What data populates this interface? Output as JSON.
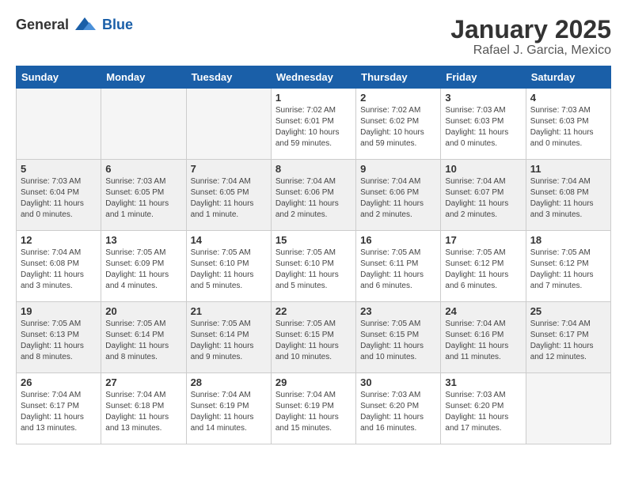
{
  "logo": {
    "general": "General",
    "blue": "Blue"
  },
  "header": {
    "title": "January 2025",
    "subtitle": "Rafael J. Garcia, Mexico"
  },
  "weekdays": [
    "Sunday",
    "Monday",
    "Tuesday",
    "Wednesday",
    "Thursday",
    "Friday",
    "Saturday"
  ],
  "weeks": [
    [
      {
        "day": "",
        "info": ""
      },
      {
        "day": "",
        "info": ""
      },
      {
        "day": "",
        "info": ""
      },
      {
        "day": "1",
        "info": "Sunrise: 7:02 AM\nSunset: 6:01 PM\nDaylight: 10 hours\nand 59 minutes."
      },
      {
        "day": "2",
        "info": "Sunrise: 7:02 AM\nSunset: 6:02 PM\nDaylight: 10 hours\nand 59 minutes."
      },
      {
        "day": "3",
        "info": "Sunrise: 7:03 AM\nSunset: 6:03 PM\nDaylight: 11 hours\nand 0 minutes."
      },
      {
        "day": "4",
        "info": "Sunrise: 7:03 AM\nSunset: 6:03 PM\nDaylight: 11 hours\nand 0 minutes."
      }
    ],
    [
      {
        "day": "5",
        "info": "Sunrise: 7:03 AM\nSunset: 6:04 PM\nDaylight: 11 hours\nand 0 minutes."
      },
      {
        "day": "6",
        "info": "Sunrise: 7:03 AM\nSunset: 6:05 PM\nDaylight: 11 hours\nand 1 minute."
      },
      {
        "day": "7",
        "info": "Sunrise: 7:04 AM\nSunset: 6:05 PM\nDaylight: 11 hours\nand 1 minute."
      },
      {
        "day": "8",
        "info": "Sunrise: 7:04 AM\nSunset: 6:06 PM\nDaylight: 11 hours\nand 2 minutes."
      },
      {
        "day": "9",
        "info": "Sunrise: 7:04 AM\nSunset: 6:06 PM\nDaylight: 11 hours\nand 2 minutes."
      },
      {
        "day": "10",
        "info": "Sunrise: 7:04 AM\nSunset: 6:07 PM\nDaylight: 11 hours\nand 2 minutes."
      },
      {
        "day": "11",
        "info": "Sunrise: 7:04 AM\nSunset: 6:08 PM\nDaylight: 11 hours\nand 3 minutes."
      }
    ],
    [
      {
        "day": "12",
        "info": "Sunrise: 7:04 AM\nSunset: 6:08 PM\nDaylight: 11 hours\nand 3 minutes."
      },
      {
        "day": "13",
        "info": "Sunrise: 7:05 AM\nSunset: 6:09 PM\nDaylight: 11 hours\nand 4 minutes."
      },
      {
        "day": "14",
        "info": "Sunrise: 7:05 AM\nSunset: 6:10 PM\nDaylight: 11 hours\nand 5 minutes."
      },
      {
        "day": "15",
        "info": "Sunrise: 7:05 AM\nSunset: 6:10 PM\nDaylight: 11 hours\nand 5 minutes."
      },
      {
        "day": "16",
        "info": "Sunrise: 7:05 AM\nSunset: 6:11 PM\nDaylight: 11 hours\nand 6 minutes."
      },
      {
        "day": "17",
        "info": "Sunrise: 7:05 AM\nSunset: 6:12 PM\nDaylight: 11 hours\nand 6 minutes."
      },
      {
        "day": "18",
        "info": "Sunrise: 7:05 AM\nSunset: 6:12 PM\nDaylight: 11 hours\nand 7 minutes."
      }
    ],
    [
      {
        "day": "19",
        "info": "Sunrise: 7:05 AM\nSunset: 6:13 PM\nDaylight: 11 hours\nand 8 minutes."
      },
      {
        "day": "20",
        "info": "Sunrise: 7:05 AM\nSunset: 6:14 PM\nDaylight: 11 hours\nand 8 minutes."
      },
      {
        "day": "21",
        "info": "Sunrise: 7:05 AM\nSunset: 6:14 PM\nDaylight: 11 hours\nand 9 minutes."
      },
      {
        "day": "22",
        "info": "Sunrise: 7:05 AM\nSunset: 6:15 PM\nDaylight: 11 hours\nand 10 minutes."
      },
      {
        "day": "23",
        "info": "Sunrise: 7:05 AM\nSunset: 6:15 PM\nDaylight: 11 hours\nand 10 minutes."
      },
      {
        "day": "24",
        "info": "Sunrise: 7:04 AM\nSunset: 6:16 PM\nDaylight: 11 hours\nand 11 minutes."
      },
      {
        "day": "25",
        "info": "Sunrise: 7:04 AM\nSunset: 6:17 PM\nDaylight: 11 hours\nand 12 minutes."
      }
    ],
    [
      {
        "day": "26",
        "info": "Sunrise: 7:04 AM\nSunset: 6:17 PM\nDaylight: 11 hours\nand 13 minutes."
      },
      {
        "day": "27",
        "info": "Sunrise: 7:04 AM\nSunset: 6:18 PM\nDaylight: 11 hours\nand 13 minutes."
      },
      {
        "day": "28",
        "info": "Sunrise: 7:04 AM\nSunset: 6:19 PM\nDaylight: 11 hours\nand 14 minutes."
      },
      {
        "day": "29",
        "info": "Sunrise: 7:04 AM\nSunset: 6:19 PM\nDaylight: 11 hours\nand 15 minutes."
      },
      {
        "day": "30",
        "info": "Sunrise: 7:03 AM\nSunset: 6:20 PM\nDaylight: 11 hours\nand 16 minutes."
      },
      {
        "day": "31",
        "info": "Sunrise: 7:03 AM\nSunset: 6:20 PM\nDaylight: 11 hours\nand 17 minutes."
      },
      {
        "day": "",
        "info": ""
      }
    ]
  ],
  "shaded_weeks": [
    1,
    3
  ],
  "empty_cells": {
    "0": [
      0,
      1,
      2
    ],
    "4": [
      6
    ]
  }
}
